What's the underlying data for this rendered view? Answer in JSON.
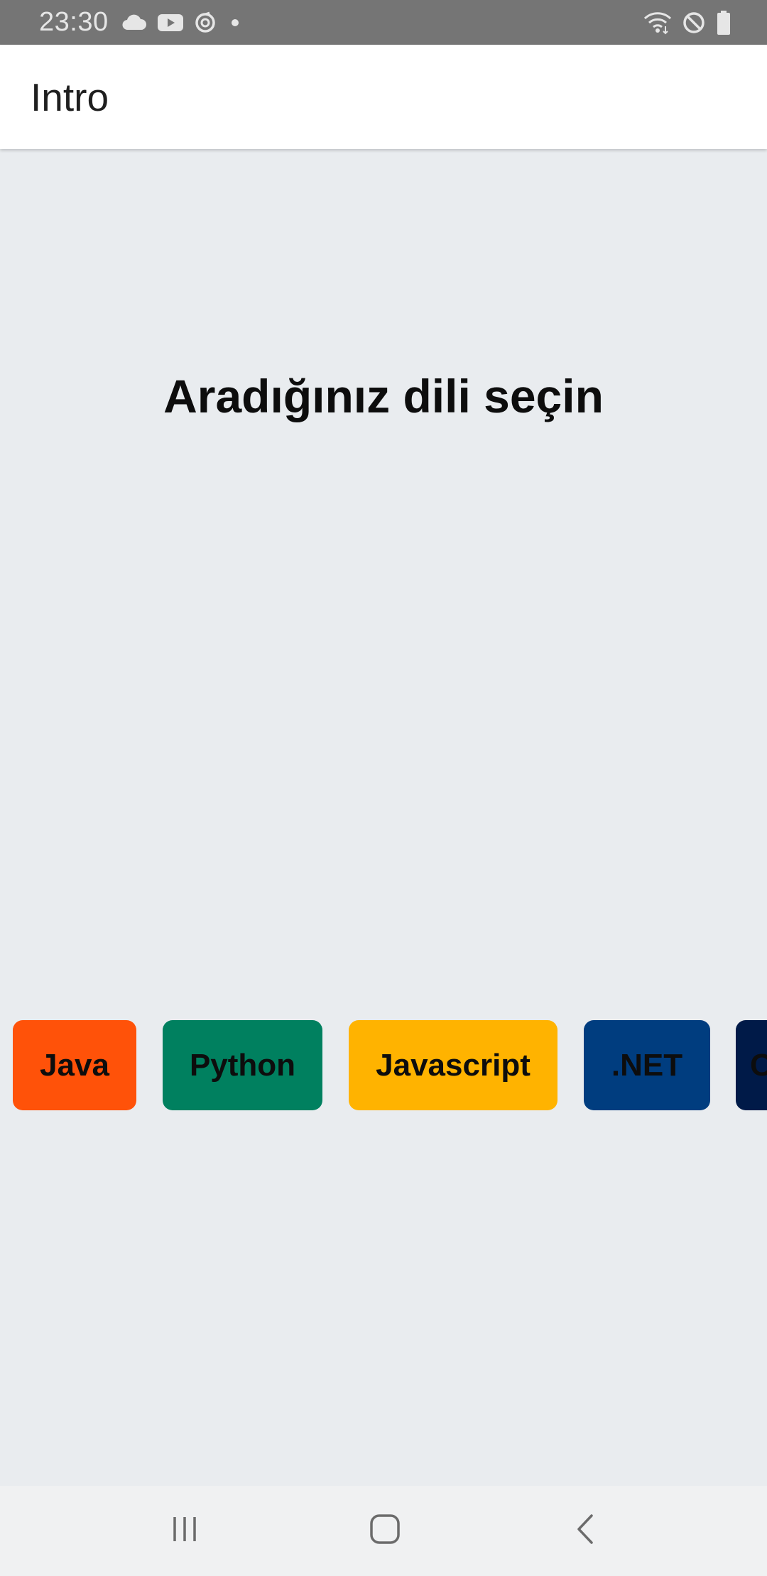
{
  "status_bar": {
    "time": "23:30",
    "left_icons": [
      "cloud-icon",
      "youtube-icon",
      "sync-icon",
      "dot-icon"
    ],
    "right_icons": [
      "wifi-icon",
      "do-not-disturb-icon",
      "battery-icon"
    ]
  },
  "app_bar": {
    "title": "Intro"
  },
  "main": {
    "heading": "Aradığınız dili seçin",
    "languages": [
      {
        "label": "Java",
        "color": "#ff5209"
      },
      {
        "label": "Python",
        "color": "#00805f"
      },
      {
        "label": "Javascript",
        "color": "#ffb300"
      },
      {
        "label": ".NET",
        "color": "#003d7f"
      },
      {
        "label": "C",
        "color": "#001a48"
      }
    ]
  },
  "nav_bar": {
    "buttons": [
      "recent-apps-icon",
      "home-icon",
      "back-icon"
    ]
  },
  "colors": {
    "status_bar": "#757575",
    "app_bar": "#ffffff",
    "background": "#e9ecef",
    "nav_bar": "#f0f1f2"
  }
}
